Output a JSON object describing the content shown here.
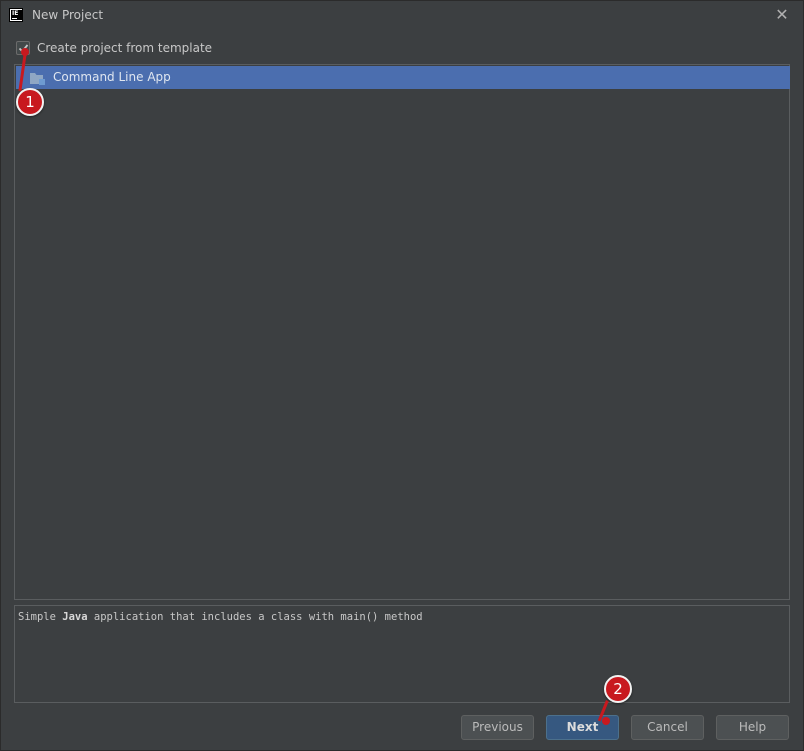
{
  "window": {
    "title": "New Project",
    "icon_text": "IE",
    "close_glyph": "✕"
  },
  "template_section": {
    "checkbox_label": "Create project from template",
    "checkbox_checked": true,
    "items": [
      {
        "label": "Command Line App",
        "icon": "folder-icon",
        "selected": true
      }
    ]
  },
  "description": {
    "prefix": "Simple ",
    "bold": "Java",
    "suffix": " application that includes a class with main() method"
  },
  "buttons": {
    "previous": "Previous",
    "next": "Next",
    "cancel": "Cancel",
    "help": "Help"
  },
  "annotations": [
    {
      "number": "1"
    },
    {
      "number": "2"
    }
  ],
  "colors": {
    "background": "#3c3f41",
    "selection": "#4b6eaf",
    "primary_button": "#365880",
    "annotation": "#c8191f"
  }
}
